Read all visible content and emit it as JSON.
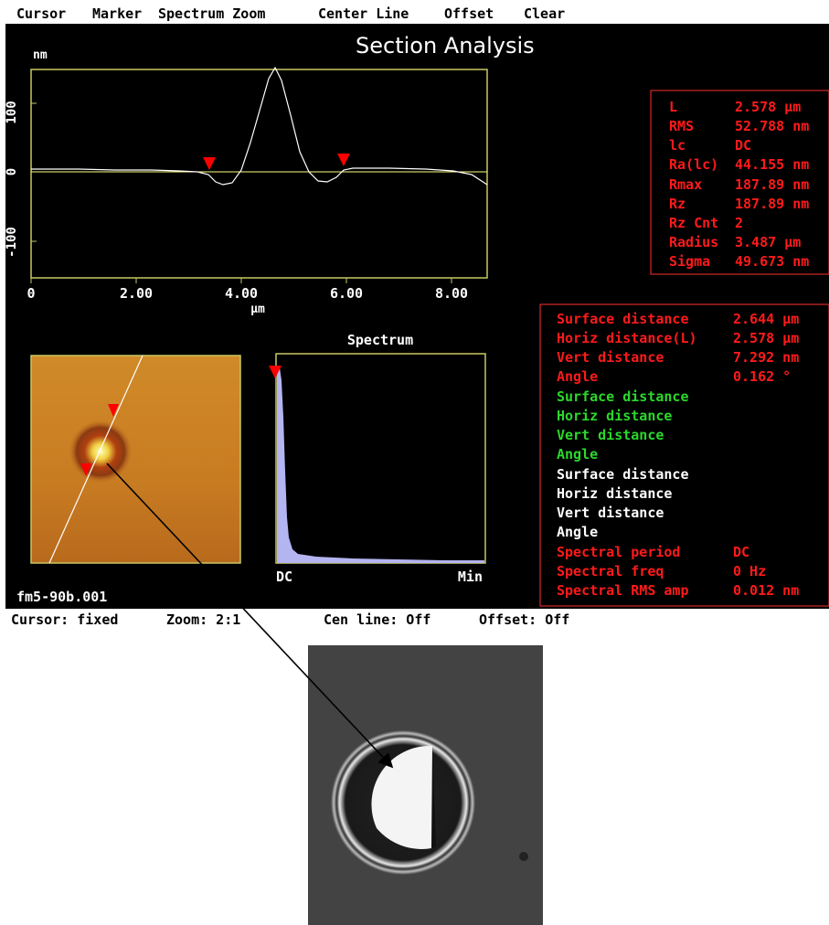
{
  "menu": [
    "Cursor",
    "Marker",
    "Spectrum Zoom",
    "Center Line",
    "Offset",
    "Clear"
  ],
  "title": "Section Analysis",
  "profile": {
    "y_unit": "nm",
    "x_unit": "μm",
    "y_ticks": [
      "100",
      "0",
      "-100"
    ],
    "x_ticks": [
      "0",
      "2.00",
      "4.00",
      "6.00",
      "8.00"
    ],
    "line_color": "#ffff80",
    "trace_color": "#ffffff"
  },
  "stats": [
    {
      "label": "L",
      "value": "2.578 μm"
    },
    {
      "label": "RMS",
      "value": "52.788 nm"
    },
    {
      "label": "lc",
      "value": "DC"
    },
    {
      "label": "Ra(lc)",
      "value": "44.155 nm"
    },
    {
      "label": "Rmax",
      "value": "187.89 nm"
    },
    {
      "label": "Rz",
      "value": "187.89 nm"
    },
    {
      "label": "Rz Cnt",
      "value": "2"
    },
    {
      "label": "Radius",
      "value": "3.487 μm"
    },
    {
      "label": "Sigma",
      "value": "49.673 nm"
    }
  ],
  "spectrum": {
    "title": "Spectrum",
    "x_left": "DC",
    "x_right": "Min"
  },
  "measurements": [
    {
      "label": "Surface distance",
      "value": "2.644 μm",
      "color": "red"
    },
    {
      "label": "Horiz distance(L)",
      "value": "2.578 μm",
      "color": "red"
    },
    {
      "label": "Vert distance",
      "value": "7.292 nm",
      "color": "red"
    },
    {
      "label": "Angle",
      "value": "0.162 °",
      "color": "red"
    },
    {
      "label": "Surface distance",
      "value": "",
      "color": "green"
    },
    {
      "label": "Horiz distance",
      "value": "",
      "color": "green"
    },
    {
      "label": "Vert distance",
      "value": "",
      "color": "green"
    },
    {
      "label": "Angle",
      "value": "",
      "color": "green"
    },
    {
      "label": "Surface distance",
      "value": "",
      "color": "white"
    },
    {
      "label": "Horiz distance",
      "value": "",
      "color": "white"
    },
    {
      "label": "Vert distance",
      "value": "",
      "color": "white"
    },
    {
      "label": "Angle",
      "value": "",
      "color": "white"
    },
    {
      "label": "Spectral period",
      "value": "DC",
      "color": "red"
    },
    {
      "label": "Spectral freq",
      "value": "0 Hz",
      "color": "red"
    },
    {
      "label": "Spectral RMS amp",
      "value": "0.012 nm",
      "color": "red"
    }
  ],
  "filename": "fm5-90b.001",
  "status": {
    "cursor": "Cursor: fixed",
    "zoom": "Zoom: 2:1",
    "cenline": "Cen line: Off",
    "offset": "Offset: Off"
  },
  "colors": {
    "marker": "#ff0000",
    "plot_frame": "#c8c864",
    "spectrum_fill": "#b4b4f0"
  }
}
